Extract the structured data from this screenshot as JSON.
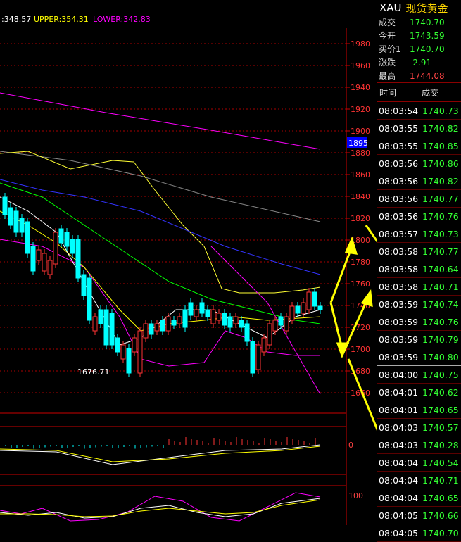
{
  "top_indicator": {
    "mid": ":348.57",
    "upper": "UPPER:354.31",
    "lower": "LOWER:342.83"
  },
  "price_axis": [
    "1980",
    "1960",
    "1940",
    "1920",
    "1900",
    "1880",
    "1860",
    "1840",
    "1820",
    "1800",
    "1780",
    "1760",
    "1740",
    "1720",
    "1700",
    "1680",
    "1660"
  ],
  "current_price_tag": "1895",
  "low_annotation": "1676.71",
  "macd_axis": "0",
  "kdj_axis": "100",
  "colors": {
    "up": "#ff3333",
    "down": "#00ffff",
    "ma5": "#ffffff",
    "ma10": "#ffff00",
    "ma20": "#ff00ff",
    "ma30": "#00ff00",
    "ma60": "#3333ff",
    "ma120": "#888888",
    "boll": "#ffff33",
    "arrow": "#ffff00"
  },
  "panel": {
    "symbol": "XAU",
    "name": "现货黄金",
    "quotes": [
      {
        "label": "成交",
        "value": "1740.70",
        "color": "#33ff33"
      },
      {
        "label": "今开",
        "value": "1743.59",
        "color": "#33ff33"
      },
      {
        "label": "买价1",
        "value": "1740.70",
        "color": "#33ff33"
      },
      {
        "label": "涨跌",
        "value": "-2.91",
        "color": "#33ff33"
      },
      {
        "label": "最高",
        "value": "1744.08",
        "color": "#ff4444"
      }
    ],
    "col_time": "时间",
    "col_price": "成交",
    "ticks": [
      {
        "time": "08:03:54",
        "price": "1740.73"
      },
      {
        "time": "08:03:55",
        "price": "1740.82"
      },
      {
        "time": "08:03:55",
        "price": "1740.85"
      },
      {
        "time": "08:03:56",
        "price": "1740.86"
      },
      {
        "time": "08:03:56",
        "price": "1740.82"
      },
      {
        "time": "08:03:56",
        "price": "1740.77"
      },
      {
        "time": "08:03:56",
        "price": "1740.76"
      },
      {
        "time": "08:03:57",
        "price": "1740.73"
      },
      {
        "time": "08:03:58",
        "price": "1740.77"
      },
      {
        "time": "08:03:58",
        "price": "1740.64"
      },
      {
        "time": "08:03:58",
        "price": "1740.71"
      },
      {
        "time": "08:03:59",
        "price": "1740.74"
      },
      {
        "time": "08:03:59",
        "price": "1740.76"
      },
      {
        "time": "08:03:59",
        "price": "1740.79"
      },
      {
        "time": "08:03:59",
        "price": "1740.80"
      },
      {
        "time": "08:04:00",
        "price": "1740.75"
      },
      {
        "time": "08:04:01",
        "price": "1740.62"
      },
      {
        "time": "08:04:01",
        "price": "1740.65"
      },
      {
        "time": "08:04:03",
        "price": "1740.57"
      },
      {
        "time": "08:04:03",
        "price": "1740.28"
      },
      {
        "time": "08:04:04",
        "price": "1740.54"
      },
      {
        "time": "08:04:04",
        "price": "1740.71"
      },
      {
        "time": "08:04:04",
        "price": "1740.65"
      },
      {
        "time": "08:04:05",
        "price": "1740.66"
      },
      {
        "time": "08:04:05",
        "price": "1740.70"
      }
    ]
  }
}
